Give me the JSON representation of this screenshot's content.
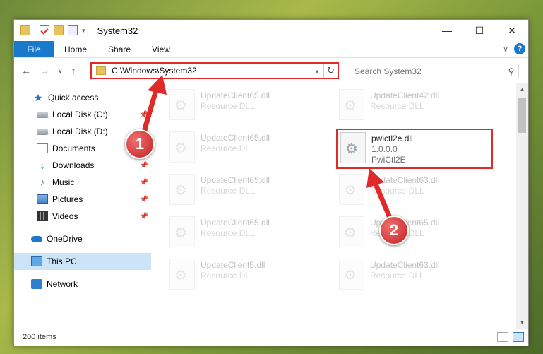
{
  "window": {
    "title": "System32",
    "controls": {
      "minimize": "—",
      "maximize": "☐",
      "close": "✕"
    }
  },
  "ribbon": {
    "tabs": [
      "File",
      "Home",
      "Share",
      "View"
    ],
    "collapse": "∨",
    "help": "?"
  },
  "address": {
    "path": "C:\\Windows\\System32",
    "search_placeholder": "Search System32"
  },
  "sidebar": {
    "items": [
      {
        "label": "Quick access",
        "icon": "star-icon",
        "pinned": false
      },
      {
        "label": "Local Disk (C:)",
        "icon": "disk-icon",
        "pinned": true
      },
      {
        "label": "Local Disk (D:)",
        "icon": "disk-icon",
        "pinned": true
      },
      {
        "label": "Documents",
        "icon": "documents-icon",
        "pinned": true
      },
      {
        "label": "Downloads",
        "icon": "downloads-icon",
        "pinned": true
      },
      {
        "label": "Music",
        "icon": "music-icon",
        "pinned": true
      },
      {
        "label": "Pictures",
        "icon": "pictures-icon",
        "pinned": true
      },
      {
        "label": "Videos",
        "icon": "videos-icon",
        "pinned": true
      },
      {
        "label": "OneDrive",
        "icon": "onedrive-icon",
        "pinned": false
      },
      {
        "label": "This PC",
        "icon": "pc-icon",
        "pinned": false,
        "selected": true
      },
      {
        "label": "Network",
        "icon": "network-icon",
        "pinned": false
      }
    ]
  },
  "files": [
    {
      "name": "UpdateClient65.dll",
      "sub": "Resource DLL",
      "faded": true
    },
    {
      "name": "UpdateClient42.dll",
      "sub": "Resource DLL",
      "faded": true
    },
    {
      "name": "UpdateClient65.dll",
      "sub": "Resource DLL",
      "faded": true
    },
    {
      "name": "pwictl2e.dll",
      "version": "1.0.0.0",
      "desc": "PwiCtl2E",
      "faded": false,
      "highlighted": true
    },
    {
      "name": "UpdateClient65.dll",
      "sub": "Resource DLL",
      "faded": true
    },
    {
      "name": "UpdateClient63.dll",
      "sub": "Resource DLL",
      "faded": true
    },
    {
      "name": "UpdateClient65.dll",
      "sub": "Resource DLL",
      "faded": true
    },
    {
      "name": "UpdateClient65.dll",
      "sub": "Resource DLL",
      "faded": true
    },
    {
      "name": "UpdateClient5.dll",
      "sub": "Resource DLL",
      "faded": true
    },
    {
      "name": "UpdateClient63.dll",
      "sub": "Resource DLL",
      "faded": true
    }
  ],
  "status": {
    "count": "200 items"
  },
  "annotations": {
    "badge1": "1",
    "badge2": "2",
    "color": "#e02a2a"
  }
}
